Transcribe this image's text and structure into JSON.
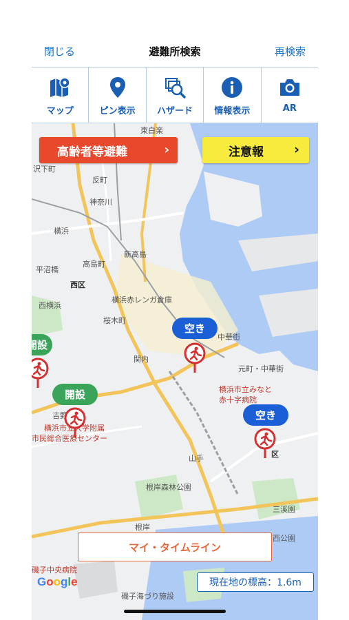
{
  "header": {
    "close_label": "閉じる",
    "title": "避難所検索",
    "research_label": "再検索"
  },
  "toolbar": {
    "items": [
      {
        "label": "マップ",
        "icon": "map-pin-icon"
      },
      {
        "label": "ピン表示",
        "icon": "location-pin-icon"
      },
      {
        "label": "ハザード",
        "icon": "hazard-search-icon"
      },
      {
        "label": "情報表示",
        "icon": "info-icon"
      },
      {
        "label": "AR",
        "icon": "camera-icon"
      }
    ]
  },
  "alerts": {
    "elderly_label": "高齢者等避難",
    "caution_label": "注意報",
    "chevron": "›"
  },
  "markers": [
    {
      "status": "空き",
      "color": "#1a5fd6"
    },
    {
      "status": "空き",
      "color": "#1a5fd6"
    },
    {
      "status": "開設",
      "color": "#3aa55a"
    },
    {
      "status": "開設",
      "color": "#3aa55a"
    }
  ],
  "places": {
    "higashi_ginza": "東白楽",
    "tanmachi": "反町",
    "kanagawa": "神奈川",
    "yokohama": "横浜",
    "takashimacho": "高島町",
    "hiranuma": "平沼橋",
    "shin_takashima": "新高島",
    "nishi_ku": "西区",
    "nishi_yokohama": "西横浜",
    "akarenga": "横浜赤レンガ倉庫",
    "sakuragicho": "桜木町",
    "chukagai": "元町・中華街",
    "chukagai_st": "中華街",
    "kannai": "関内",
    "minato_red_cross_1": "横浜市立みなと",
    "minato_red_cross_2": "赤十字病院",
    "city_univ_1": "横浜市立大学附属",
    "city_univ_2": "市民総合医療センター",
    "yoshinocho": "吉野町",
    "yamate": "山手",
    "negishi_forest": "根岸森林公園",
    "sankeien": "三溪園",
    "negishi": "根岸",
    "isogo_hospital": "磯子中央病院",
    "isogo_fishing": "磯子海づり施設",
    "park": "西公園",
    "ward": "区",
    "sawatari": "沢下町"
  },
  "timeline_label": "マイ・タイムライン",
  "elevation_label": "現在地の標高：1.6m",
  "google_logo": "Google",
  "colors": {
    "accent": "#1a5fb4",
    "danger": "#e8492c",
    "caution": "#f7ec3e",
    "open": "#3aa55a",
    "vacant": "#1a5fd6",
    "pin": "#d33131"
  }
}
